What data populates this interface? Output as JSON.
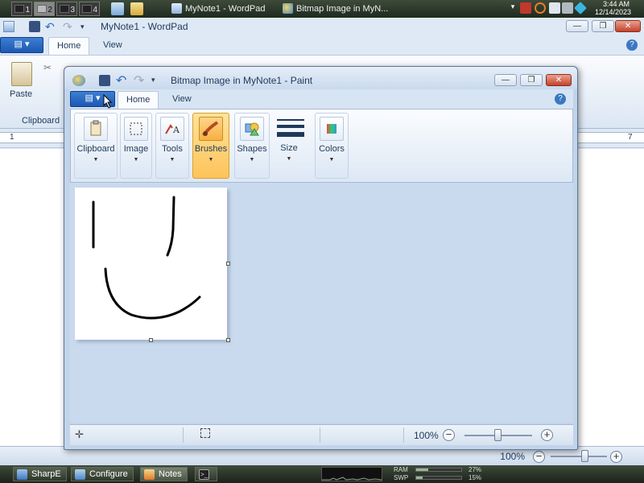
{
  "top_taskbar": {
    "workspaces": [
      "1",
      "2",
      "3",
      "4"
    ],
    "active_workspace": "2",
    "tasks": [
      {
        "label": "MyNote1 - WordPad",
        "icon": "wordpad-icon"
      },
      {
        "label": "Bitmap Image in MyN...",
        "icon": "paint-icon"
      }
    ],
    "clock_time": "3:44 AM",
    "clock_date": "12/14/2023"
  },
  "wordpad": {
    "title": "MyNote1 - WordPad",
    "tabs": [
      "Home",
      "View"
    ],
    "paste_label": "Paste",
    "clipboard_label": "Clipboard",
    "ruler_start": "1",
    "ruler_end": "7",
    "zoom_label": "100%"
  },
  "paint": {
    "title": "Bitmap Image in MyNote1 - Paint",
    "tabs": [
      "Home",
      "View"
    ],
    "groups": [
      {
        "label": "Clipboard",
        "icon": "clipboard-icon",
        "selected": false
      },
      {
        "label": "Image",
        "icon": "select-icon",
        "selected": false
      },
      {
        "label": "Tools",
        "icon": "tools-icon",
        "selected": false
      },
      {
        "label": "Brushes",
        "icon": "brush-icon",
        "selected": true
      },
      {
        "label": "Shapes",
        "icon": "shapes-icon",
        "selected": false
      },
      {
        "label": "Size",
        "icon": "size-icon",
        "selected": false
      },
      {
        "label": "Colors",
        "icon": "colors-icon",
        "selected": false
      }
    ],
    "zoom_label": "100%",
    "zoom_level_percent": 100
  },
  "bottom_taskbar": {
    "tasks": [
      {
        "label": "SharpE",
        "icon": "sharpe-icon"
      },
      {
        "label": "Configure",
        "icon": "configure-icon"
      },
      {
        "label": "Notes",
        "icon": "notes-icon"
      },
      {
        "label": "",
        "icon": "terminal-icon"
      }
    ],
    "ram_label": "RAM",
    "swp_label": "SWP",
    "ram_percent": "27%",
    "swp_percent": "15%",
    "ram_fraction": 0.27,
    "swp_fraction": 0.15
  },
  "colors": {
    "ribbon_bg": "#dfe9f5",
    "selected_group": "#fdc35a",
    "close_button": "#c4432b"
  }
}
